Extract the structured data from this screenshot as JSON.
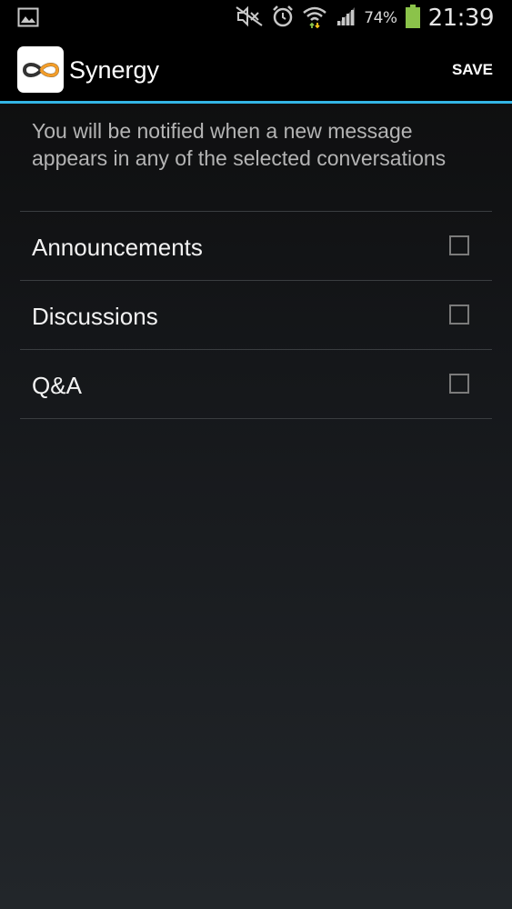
{
  "status_bar": {
    "icons": [
      "image-notification-icon",
      "mute-icon",
      "alarm-icon",
      "wifi-icon",
      "signal-icon",
      "battery-icon"
    ],
    "battery_percent": "74%",
    "time": "21:39",
    "battery_color": "#8bc34a"
  },
  "action_bar": {
    "app_icon": "synergy-infinity-icon",
    "title": "Synergy",
    "save_label": "SAVE",
    "accent_color": "#33b5e5"
  },
  "description": "You will be notified when a new message appears in any of the selected conversations",
  "conversations": [
    {
      "label": "Announcements",
      "checked": false
    },
    {
      "label": "Discussions",
      "checked": false
    },
    {
      "label": "Q&A",
      "checked": false
    }
  ]
}
